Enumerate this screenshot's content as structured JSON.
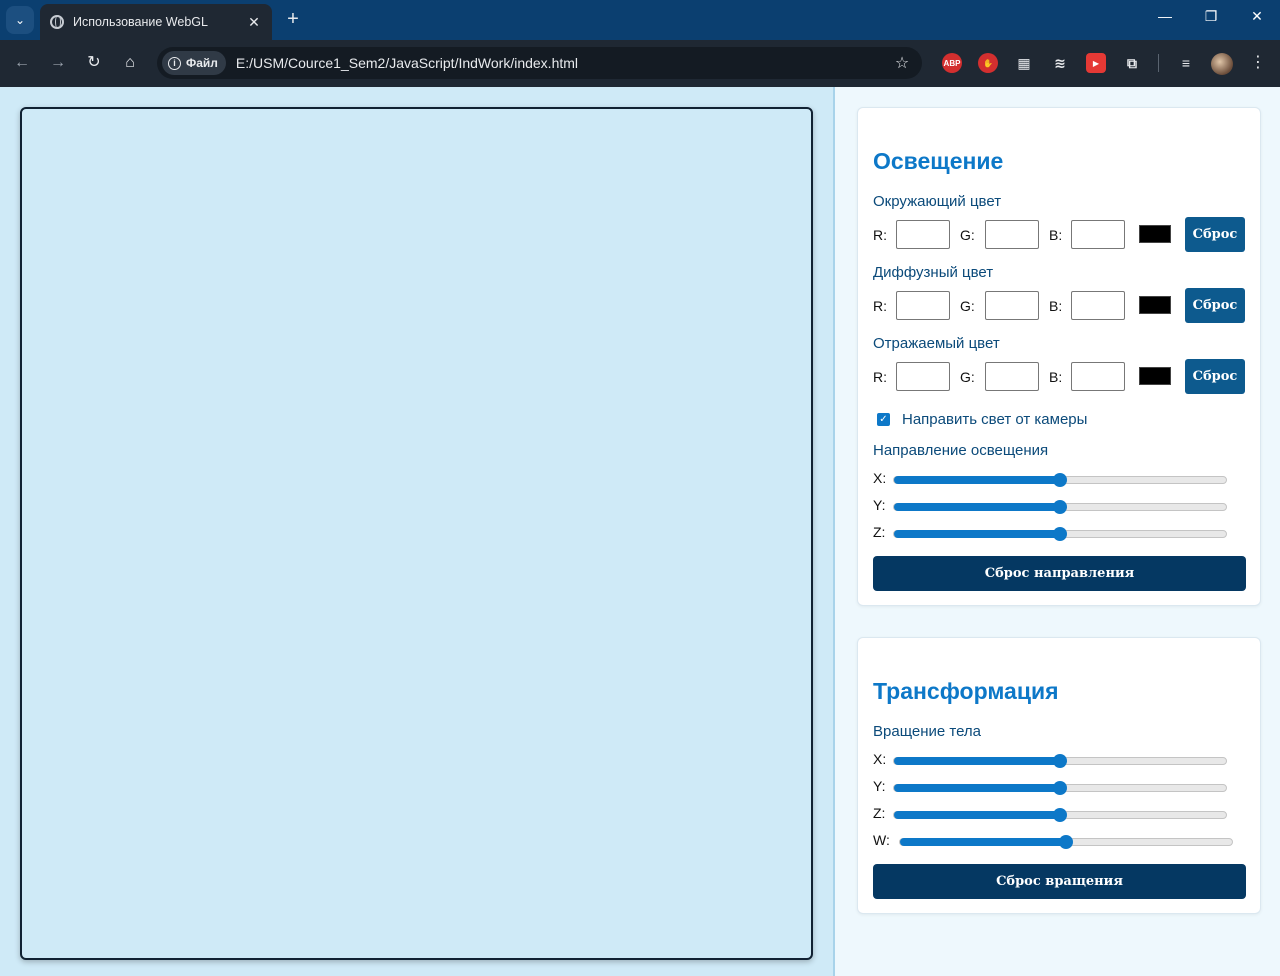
{
  "browser": {
    "tab_title": "Использование WebGL",
    "file_chip": "Файл",
    "url": "E:/USM/Cource1_Sem2/JavaScript/IndWork/index.html",
    "extensions": [
      "ABP"
    ]
  },
  "lighting": {
    "title": "Освещение",
    "ambient": {
      "label": "Окружающий цвет",
      "r_label": "R:",
      "g_label": "G:",
      "b_label": "B:",
      "r": "",
      "g": "",
      "b": "",
      "swatch": "#000000",
      "reset": "Сброс"
    },
    "diffuse": {
      "label": "Диффузный цвет",
      "r_label": "R:",
      "g_label": "G:",
      "b_label": "B:",
      "r": "",
      "g": "",
      "b": "",
      "swatch": "#000000",
      "reset": "Сброс"
    },
    "specular": {
      "label": "Отражаемый цвет",
      "r_label": "R:",
      "g_label": "G:",
      "b_label": "B:",
      "r": "",
      "g": "",
      "b": "",
      "swatch": "#000000",
      "reset": "Сброс"
    },
    "camera_light": {
      "label": "Направить свет от камеры",
      "checked": true
    },
    "direction": {
      "label": "Направление освещения",
      "sliders": [
        {
          "axis": "X:",
          "value": 0.5
        },
        {
          "axis": "Y:",
          "value": 0.5
        },
        {
          "axis": "Z:",
          "value": 0.5
        }
      ],
      "reset": "Сброс направления"
    }
  },
  "transform": {
    "title": "Трансформация",
    "rotation": {
      "label": "Вращение тела",
      "sliders": [
        {
          "axis": "X:",
          "value": 0.5
        },
        {
          "axis": "Y:",
          "value": 0.5
        },
        {
          "axis": "Z:",
          "value": 0.5
        },
        {
          "axis": "W:",
          "value": 0.5
        }
      ],
      "reset": "Сброс вращения"
    }
  },
  "colors": {
    "accent": "#0d78c8",
    "dark_button": "#053862",
    "reset_button": "#0d5a8e",
    "page_background": "#cfeaf7"
  }
}
